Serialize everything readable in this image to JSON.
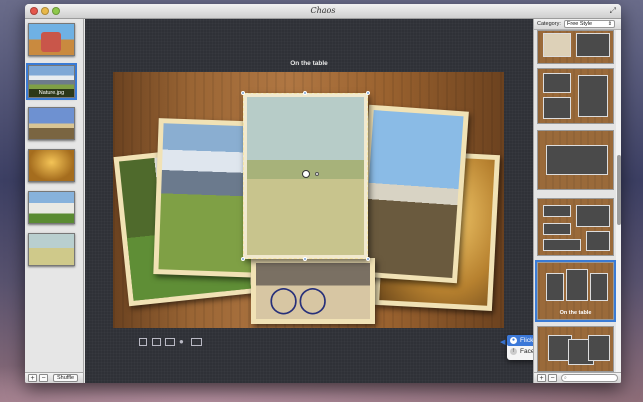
{
  "window": {
    "title": "Chaos"
  },
  "left_sidebar": {
    "thumbnails": [
      {
        "caption": ""
      },
      {
        "caption": "Nature.jpg"
      },
      {
        "caption": ""
      },
      {
        "caption": ""
      },
      {
        "caption": ""
      },
      {
        "caption": ""
      }
    ],
    "selected_index": 1,
    "add_label": "+",
    "remove_label": "−",
    "shuffle_label": "Shuffle"
  },
  "canvas": {
    "collage_title": "On the table"
  },
  "share_menu": {
    "items": [
      {
        "label": "Flickr",
        "icon": "flickr-icon",
        "active": true
      },
      {
        "label": "Facebook",
        "icon": "facebook-icon",
        "active": false
      }
    ]
  },
  "right_panel": {
    "category_label": "Category:",
    "category_value": "Free Style",
    "selected_template_caption": "On the table",
    "add_label": "+",
    "remove_label": "−"
  },
  "colors": {
    "selection_blue": "#3a7bd5",
    "wood": "#9a6534",
    "canvas_bg": "#2f3137"
  }
}
